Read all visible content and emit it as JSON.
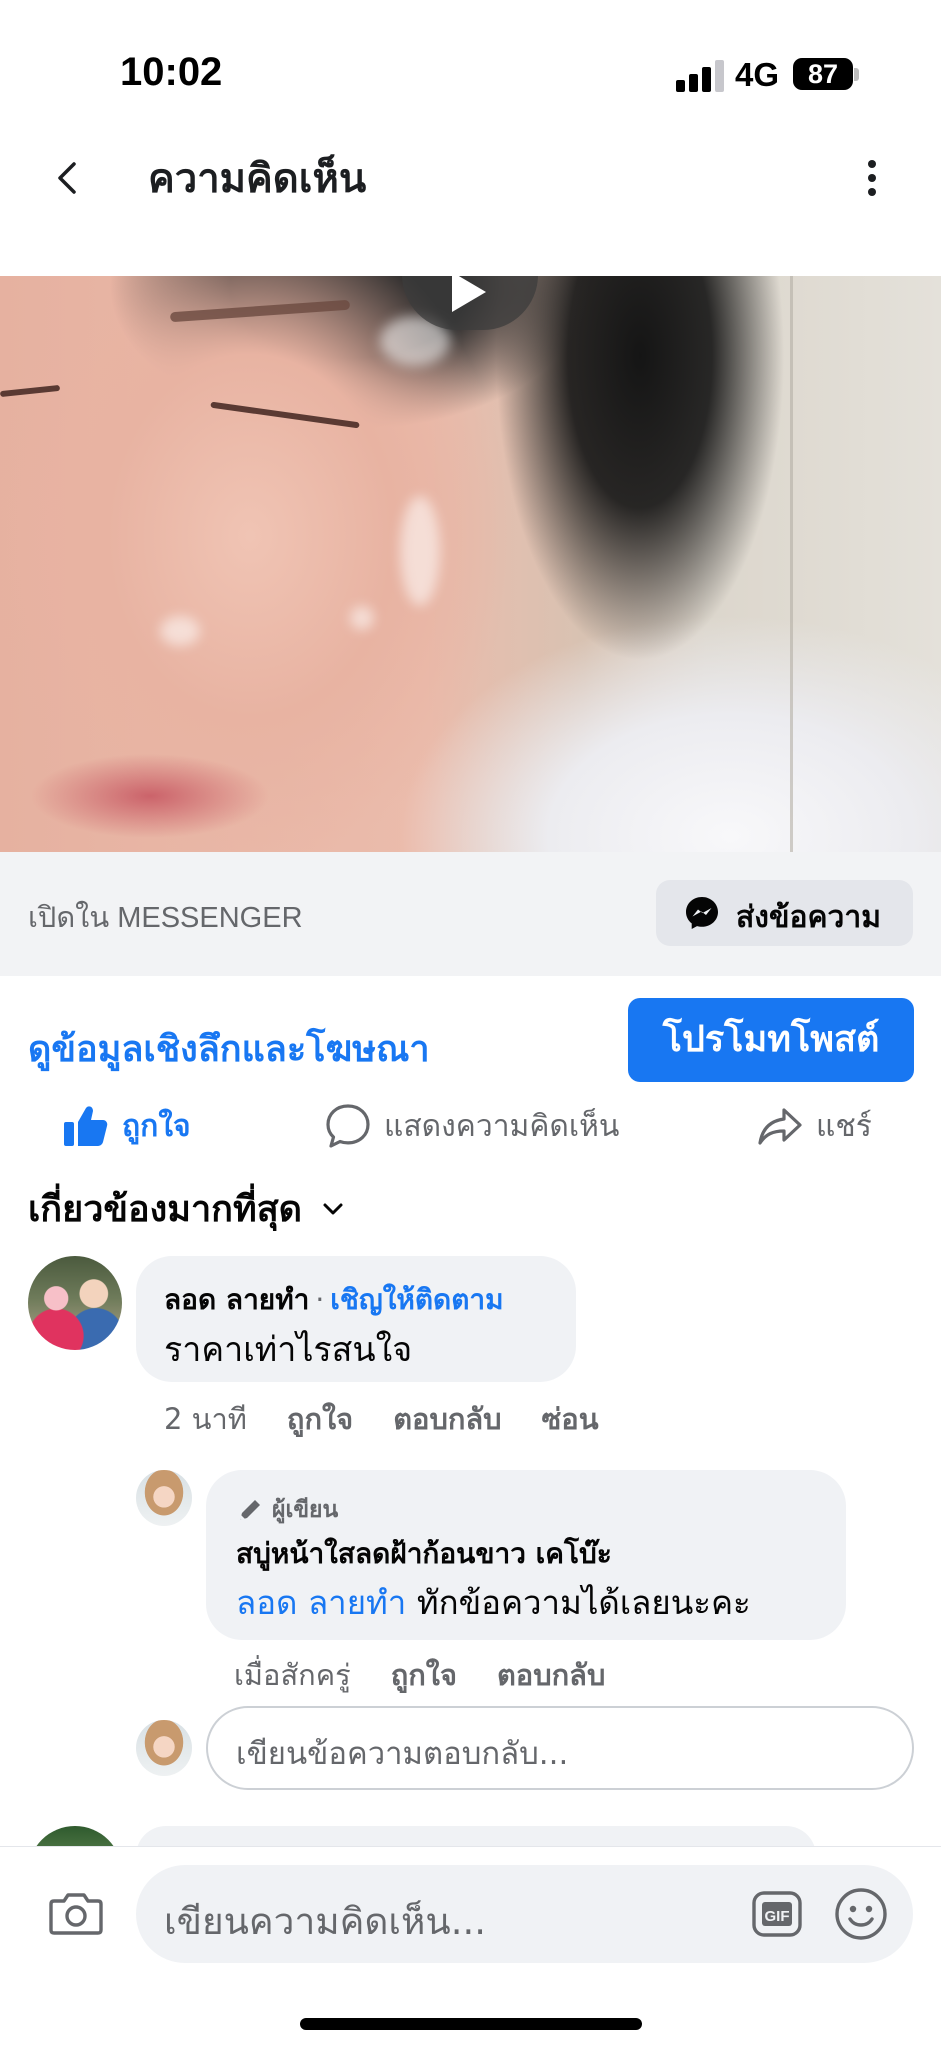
{
  "status_bar": {
    "time": "10:02",
    "network": "4G",
    "battery": "87"
  },
  "header": {
    "title": "ความคิดเห็น"
  },
  "messenger_bar": {
    "open_in": "เปิดใน MESSENGER",
    "send_label": "ส่งข้อความ"
  },
  "promo": {
    "insights_link": "ดูข้อมูลเชิงลึกและโฆษณา",
    "promote_button": "โปรโมทโพสต์"
  },
  "actions": {
    "like": "ถูกใจ",
    "comment": "แสดงความคิดเห็น",
    "share": "แชร์"
  },
  "sort": {
    "label": "เกี่ยวข้องมากที่สุด"
  },
  "comments": [
    {
      "author": "ลอด ลายทำ",
      "separator": "·",
      "follow": "เชิญให้ติดตาม",
      "text": "ราคาเท่าไรสนใจ",
      "time": "2 นาที",
      "like": "ถูกใจ",
      "reply": "ตอบกลับ",
      "hide": "ซ่อน",
      "replies": [
        {
          "badge": "ผู้เขียน",
          "author": "สบู่หน้าใสลดฝ้าก้อนขาว เคโบ๊ะ",
          "mention": "ลอด ลายทำ",
          "text": " ทักข้อความได้เลยนะคะ",
          "time": "เมื่อสักครู่",
          "like": "ถูกใจ",
          "reply": "ตอบกลับ"
        }
      ]
    }
  ],
  "reply_input": {
    "placeholder": "เขียนข้อความตอบกลับ..."
  },
  "composer": {
    "placeholder": "เขียนความคิดเห็น..."
  },
  "icons": {
    "back": "chevron-left-icon",
    "more": "more-vertical-icon",
    "messenger": "messenger-icon",
    "like": "thumbs-up-icon",
    "comment": "comment-bubble-icon",
    "share": "share-arrow-icon",
    "camera": "camera-icon",
    "gif": "gif-icon",
    "emoji": "emoji-icon"
  },
  "colors": {
    "accent": "#1877f2",
    "muted_text": "#65676b",
    "bubble": "#f0f2f5"
  }
}
